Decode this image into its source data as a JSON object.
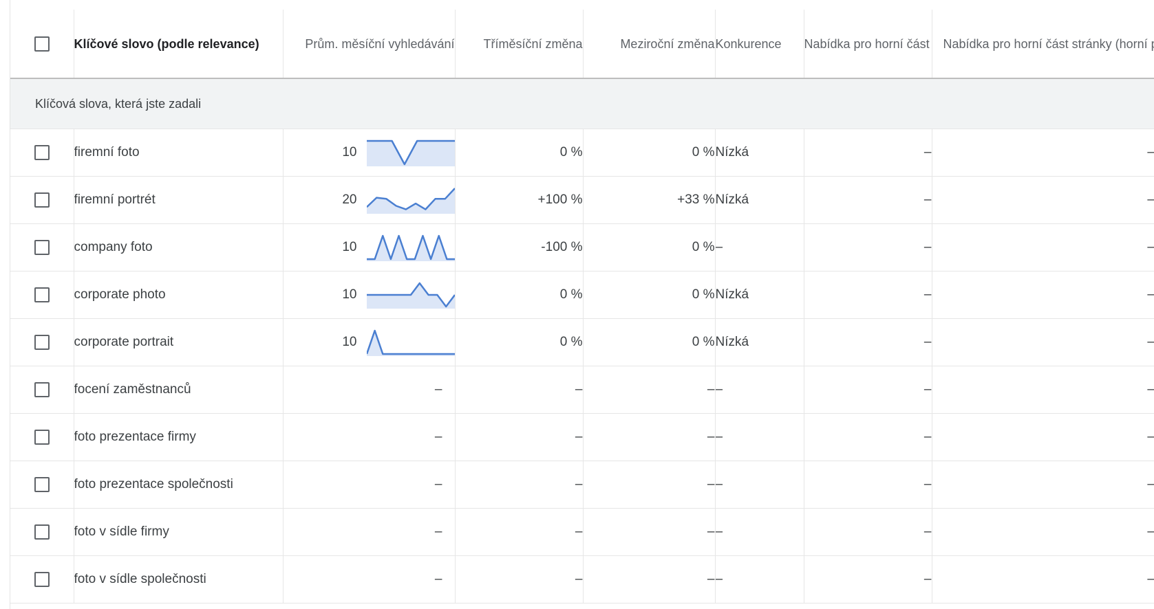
{
  "columns": {
    "keyword": "Klíčové slovo (podle relevance)",
    "avg_searches": "Prům. měsíční vyhledávání",
    "three_month_change": "Tříměsíční změna",
    "yoy_change": "Meziroční změna",
    "competition": "Konkurence",
    "bid_low": "Nabídka pro horní část stránky (spodní pásmo)",
    "bid_high": "Nabídka pro horní část stránky (horní pásmo)"
  },
  "group_label": "Klíčová slova, která jste zadali",
  "colors": {
    "sparkline": "#4a7fd1",
    "sparkline_fill": "#dce6f7",
    "group_background": "#f1f3f4",
    "header_rule": "#bdbdbd"
  },
  "rows": [
    {
      "keyword": "firemní foto",
      "searches": "10",
      "trend": [
        1,
        1,
        1,
        0,
        1,
        1,
        1,
        1
      ],
      "three_month": "0 %",
      "yoy": "0 %",
      "competition": "Nízká",
      "bid_low": "–",
      "bid_high": "–"
    },
    {
      "keyword": "firemní portrét",
      "searches": "20",
      "trend": [
        0.2,
        0.6,
        0.55,
        0.25,
        0.1,
        0.35,
        0.1,
        0.55,
        0.55,
        1
      ],
      "three_month": "+100 %",
      "yoy": "+33 %",
      "competition": "Nízká",
      "bid_low": "–",
      "bid_high": "–"
    },
    {
      "keyword": "company foto",
      "searches": "10",
      "trend": [
        0,
        0,
        1,
        0,
        1,
        0,
        0,
        1,
        0,
        1,
        0,
        0
      ],
      "three_month": "-100 %",
      "yoy": "0 %",
      "competition": "–",
      "bid_low": "–",
      "bid_high": "–"
    },
    {
      "keyword": "corporate photo",
      "searches": "10",
      "trend": [
        0.5,
        0.5,
        0.5,
        0.5,
        0.5,
        0.5,
        1,
        0.5,
        0.5,
        0,
        0.5
      ],
      "three_month": "0 %",
      "yoy": "0 %",
      "competition": "Nízká",
      "bid_low": "–",
      "bid_high": "–"
    },
    {
      "keyword": "corporate portrait",
      "searches": "10",
      "trend": [
        0,
        1,
        0,
        0,
        0,
        0,
        0,
        0,
        0,
        0,
        0,
        0
      ],
      "three_month": "0 %",
      "yoy": "0 %",
      "competition": "Nízká",
      "bid_low": "–",
      "bid_high": "–"
    },
    {
      "keyword": "focení zaměstnanců",
      "searches": "–",
      "trend": [],
      "three_month": "–",
      "yoy": "–",
      "competition": "–",
      "bid_low": "–",
      "bid_high": "–"
    },
    {
      "keyword": "foto prezentace firmy",
      "searches": "–",
      "trend": [],
      "three_month": "–",
      "yoy": "–",
      "competition": "–",
      "bid_low": "–",
      "bid_high": "–"
    },
    {
      "keyword": "foto prezentace společnosti",
      "searches": "–",
      "trend": [],
      "three_month": "–",
      "yoy": "–",
      "competition": "–",
      "bid_low": "–",
      "bid_high": "–"
    },
    {
      "keyword": "foto v sídle firmy",
      "searches": "–",
      "trend": [],
      "three_month": "–",
      "yoy": "–",
      "competition": "–",
      "bid_low": "–",
      "bid_high": "–"
    },
    {
      "keyword": "foto v sídle společnosti",
      "searches": "–",
      "trend": [],
      "three_month": "–",
      "yoy": "–",
      "competition": "–",
      "bid_low": "–",
      "bid_high": "–"
    }
  ]
}
